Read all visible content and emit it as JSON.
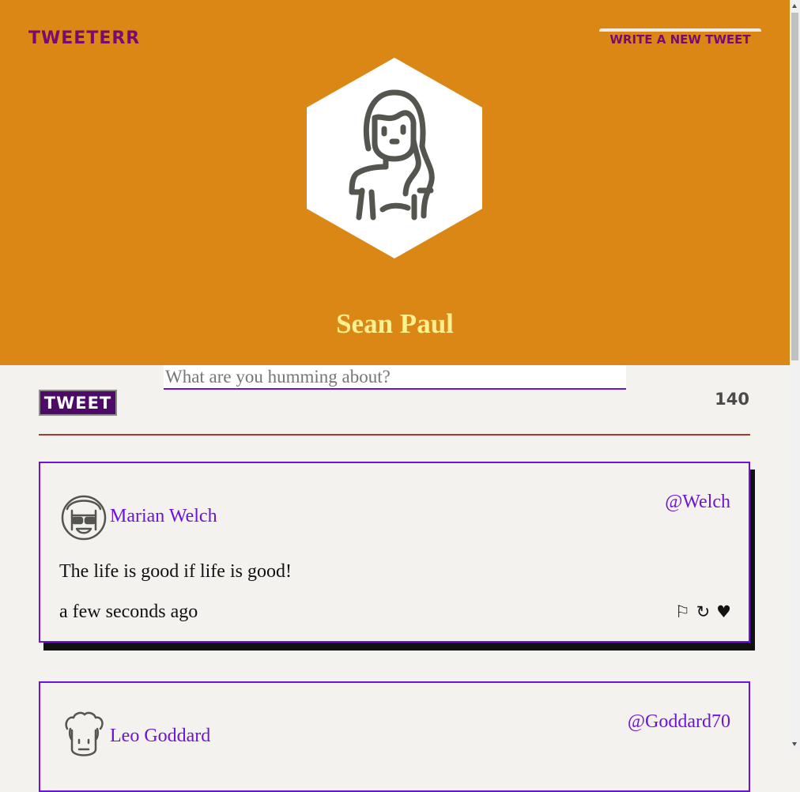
{
  "nav": {
    "brand": "TWEETERR",
    "compose_label": "WRITE A NEW TWEET"
  },
  "profile": {
    "name": "Sean Paul",
    "avatar_icon": "woman-avatar-icon"
  },
  "composer": {
    "placeholder": "What are you humming about?",
    "button_label": "TWEET",
    "counter": "140"
  },
  "tweets": [
    {
      "name": "Marian Welch",
      "handle": "@Welch",
      "text": "The life is good if life is good!",
      "time": "a few seconds ago",
      "avatar_icon": "woman-sunglasses-avatar-icon"
    },
    {
      "name": "Leo Goddard",
      "handle": "@Goddard70",
      "avatar_icon": "curly-hair-man-avatar-icon"
    }
  ],
  "actions": {
    "flag": "⚐",
    "retweet": "↻",
    "like": "♥"
  },
  "colors": {
    "header_bg": "#db8716",
    "brand": "#7a0b6e",
    "name": "#fdf08f",
    "accent": "#6d13d9",
    "button_bg": "#4d0a67",
    "divider": "#a43a35",
    "page_bg": "#f4f2ef"
  }
}
